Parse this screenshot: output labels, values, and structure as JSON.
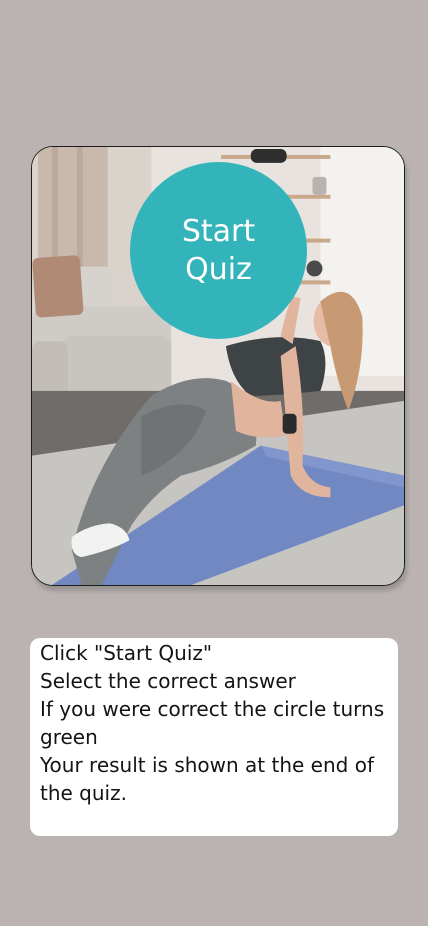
{
  "hero": {
    "image_alt": "Woman doing a reverse tabletop exercise on a blue yoga mat in a living room"
  },
  "start_button": {
    "line1": "Start",
    "line2": "Quiz",
    "color": "#33b3ba"
  },
  "instructions": {
    "lines": [
      "Click \"Start Quiz\"",
      "Select the correct answer",
      "If you were correct the circle turns green",
      "Your result is shown at the end of the quiz."
    ]
  },
  "colors": {
    "background": "#bab3b1",
    "card": "#ffffff",
    "accent": "#33b3ba"
  }
}
